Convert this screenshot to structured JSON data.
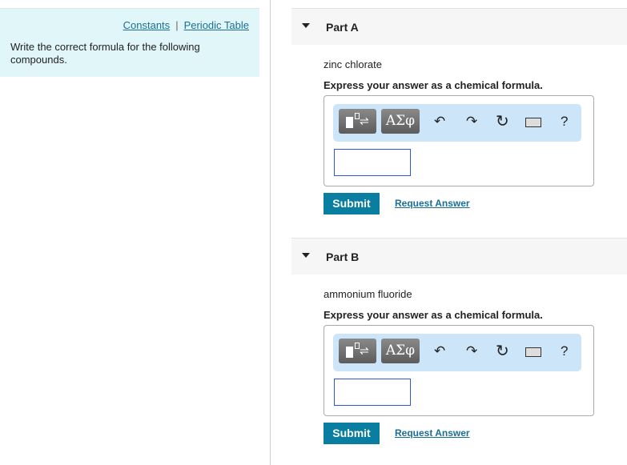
{
  "intro": {
    "links": [
      "Constants",
      "Periodic Table"
    ],
    "separator": "|",
    "text": "Write the correct formula for the following compounds."
  },
  "toolbar": {
    "greek_label": "ΑΣφ",
    "help": "?"
  },
  "parts": [
    {
      "title": "Part A",
      "question": "zinc chlorate",
      "instruction": "Express your answer as a chemical formula.",
      "answer": "",
      "submit": "Submit",
      "request": "Request Answer"
    },
    {
      "title": "Part B",
      "question": "ammonium fluoride",
      "instruction": "Express your answer as a chemical formula.",
      "answer": "",
      "submit": "Submit",
      "request": "Request Answer"
    }
  ]
}
